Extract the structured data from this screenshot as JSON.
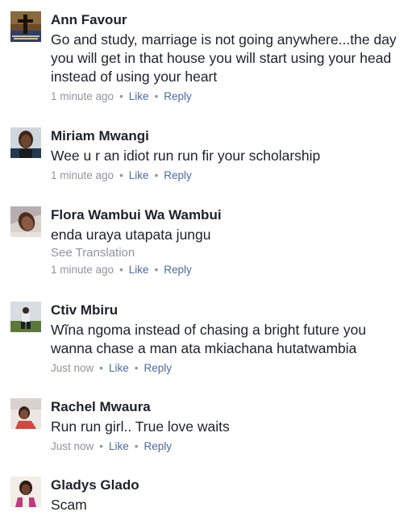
{
  "comments": [
    {
      "author": "Ann Favour",
      "text": "Go and study, marriage is not going anywhere...the day you will get in that house you will start using your head instead of using your heart",
      "time": "1 minute ago",
      "like": "Like",
      "reply": "Reply"
    },
    {
      "author": "Miriam Mwangi",
      "text": "Wee u r an idiot run run fir your scholarship",
      "time": "1 minute ago",
      "like": "Like",
      "reply": "Reply"
    },
    {
      "author": "Flora Wambui Wa Wambui",
      "text": "enda uraya utapata jungu",
      "translation": "See Translation",
      "time": "1 minute ago",
      "like": "Like",
      "reply": "Reply"
    },
    {
      "author": "Ctiv Mbiru",
      "text": "Wĩna ngoma instead of chasing a bright future you wanna chase a man ata mkiachana hutatwambia",
      "time": "Just now",
      "like": "Like",
      "reply": "Reply"
    },
    {
      "author": "Rachel Mwaura",
      "text": "Run run girl.. True love waits",
      "time": "Just now",
      "like": "Like",
      "reply": "Reply"
    },
    {
      "author": "Gladys Glado",
      "text": "Scam"
    }
  ],
  "separator": "•"
}
